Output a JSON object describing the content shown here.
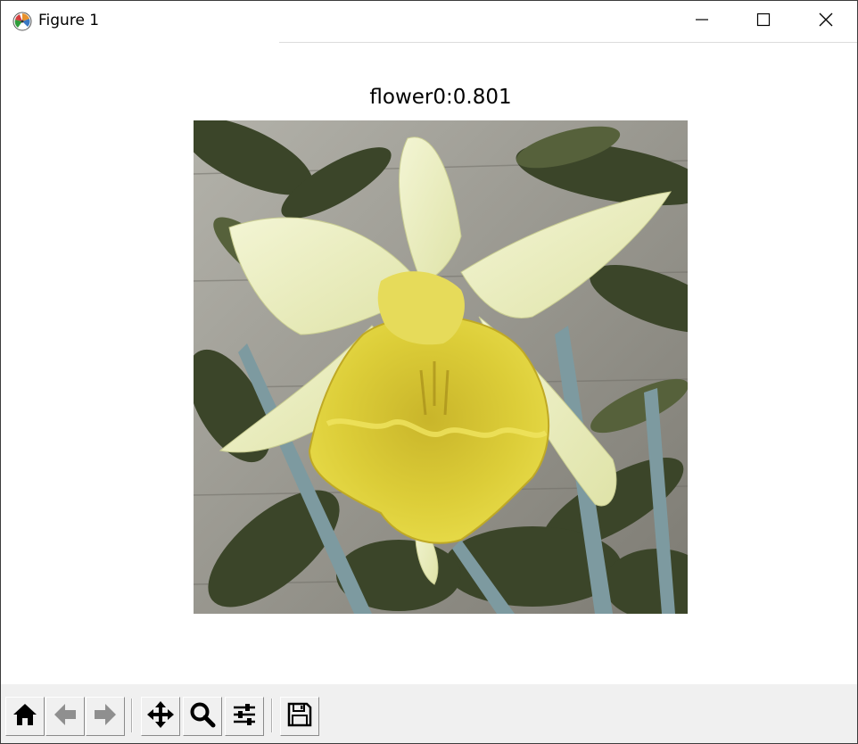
{
  "window": {
    "title": "Figure 1",
    "icon": "matplotlib-logo-icon",
    "controls": [
      "minimize-icon",
      "maximize-icon",
      "close-icon"
    ]
  },
  "figure": {
    "title": "flower0:0.801",
    "image": {
      "subject": "daffodil-photo",
      "colors": {
        "petal": "#eef1c4",
        "trumpet": "#d8c832",
        "trumpet_dark": "#b9a41c",
        "leaves": "#3d4a2c",
        "background_wall": "#9c9a92"
      }
    }
  },
  "toolbar": {
    "tools": [
      {
        "name": "home",
        "icon": "home-icon"
      },
      {
        "name": "back",
        "icon": "arrow-left-icon"
      },
      {
        "name": "forward",
        "icon": "arrow-right-icon"
      },
      {
        "name": "pan",
        "icon": "move-icon"
      },
      {
        "name": "zoom",
        "icon": "magnifier-icon"
      },
      {
        "name": "configure-subplots",
        "icon": "sliders-icon"
      },
      {
        "name": "save",
        "icon": "floppy-disk-icon"
      }
    ]
  }
}
